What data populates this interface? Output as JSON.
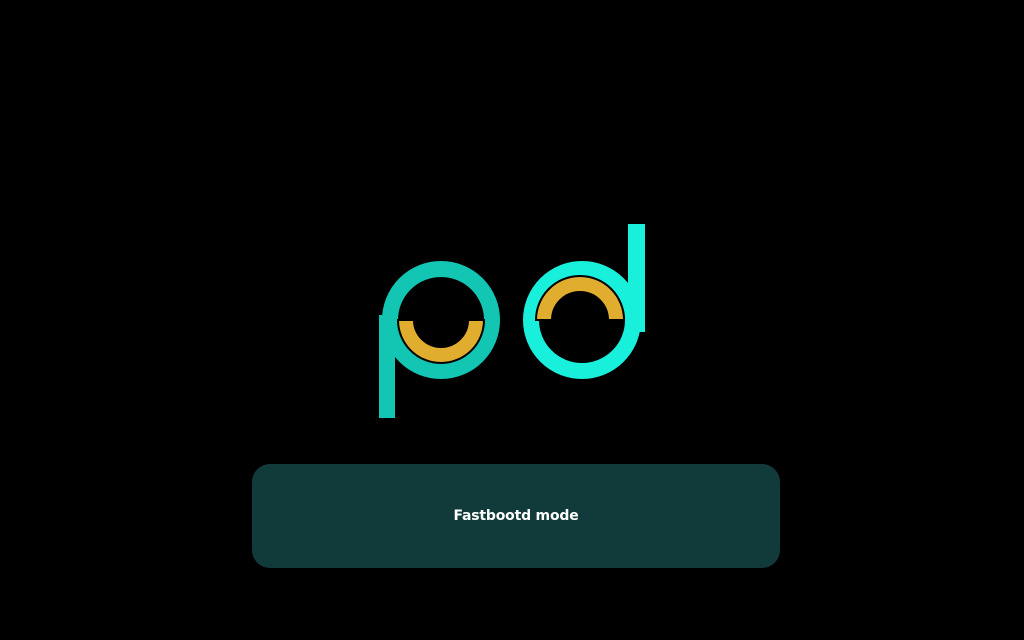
{
  "logo": {
    "icon": "pd-logo-icon",
    "colors": {
      "p_ring": "#12c6b3",
      "d_ring": "#18f0dc",
      "accent": "#e0ad2f",
      "background": "#000000"
    }
  },
  "panel": {
    "label": "Fastbootd mode",
    "background": "#113a3a",
    "text_color": "#ffffff"
  }
}
